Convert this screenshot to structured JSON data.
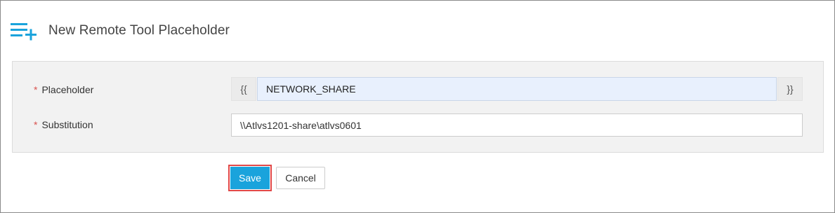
{
  "header": {
    "icon": "list-add-icon",
    "title": "New Remote Tool Placeholder"
  },
  "form": {
    "required_marker": "*",
    "placeholder": {
      "label": "Placeholder",
      "open_brace": "{{",
      "value": "NETWORK_SHARE",
      "close_brace": "}}"
    },
    "substitution": {
      "label": "Substitution",
      "value": "\\\\Atlvs1201-share\\atlvs0601"
    }
  },
  "actions": {
    "save_label": "Save",
    "cancel_label": "Cancel"
  },
  "colors": {
    "accent": "#1aa3dc",
    "required": "#d9534f",
    "highlight_border": "#e04848",
    "autofill_bg": "#e8f0fd"
  }
}
